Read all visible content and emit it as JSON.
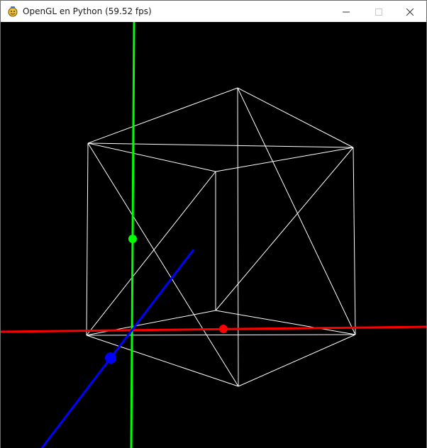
{
  "window": {
    "title": "OpenGL en Python (59.52 fps)",
    "icon": "pygame-snake-icon"
  },
  "caption_buttons": {
    "minimize": "minimize-icon",
    "maximize": "maximize-icon",
    "close": "close-icon"
  },
  "scene": {
    "background": "#000000",
    "colors": {
      "x_axis": "#ff0000",
      "y_axis": "#00ff00",
      "z_axis": "#0000ff",
      "wireframe": "#ffffff"
    }
  }
}
